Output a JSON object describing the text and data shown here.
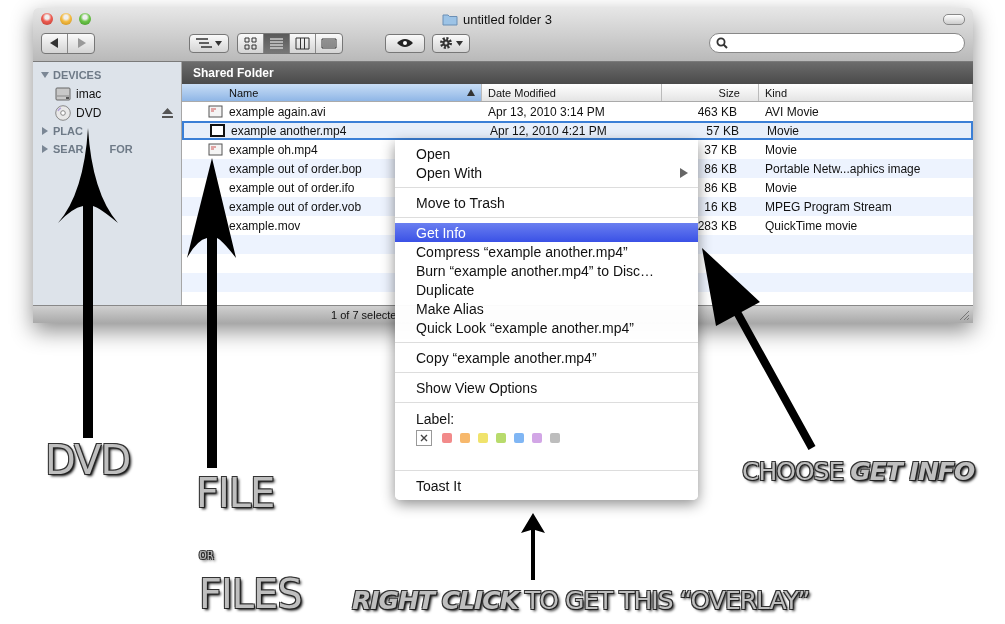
{
  "window": {
    "title": "untitled folder 3"
  },
  "toolbar": {
    "view_buttons": [
      {
        "selected": false
      },
      {
        "selected": true
      },
      {
        "selected": false
      },
      {
        "selected": false
      }
    ]
  },
  "sidebar": {
    "sections": [
      {
        "label": "DEVICES",
        "expanded": true,
        "items": [
          {
            "label": "imac",
            "kind": "disk",
            "ejectable": false
          },
          {
            "label": "DVD",
            "kind": "disc",
            "ejectable": true
          }
        ]
      },
      {
        "label": "PLAC",
        "expanded": false
      },
      {
        "label": "SEAR",
        "label_after": "FOR",
        "expanded": false
      }
    ]
  },
  "content": {
    "title": "Shared Folder",
    "columns": [
      {
        "label": "Name",
        "selected": true
      },
      {
        "label": "Date Modified",
        "selected": false
      },
      {
        "label": "Size",
        "selected": false
      },
      {
        "label": "Kind",
        "selected": false
      }
    ],
    "rows": [
      {
        "name": "example again.avi",
        "date": "Apr 13, 2010 3:14 PM",
        "size": "463 KB",
        "kind": "AVI Movie",
        "icon": true,
        "selected": false
      },
      {
        "name": "example another.mp4",
        "date": "Apr 12, 2010 4:21 PM",
        "size": "57 KB",
        "kind": "Movie",
        "icon": true,
        "selected": true
      },
      {
        "name": "example oh.mp4",
        "size": "37 KB",
        "kind": "Movie",
        "icon": true,
        "selected": false
      },
      {
        "name": "example out of order.bop",
        "size": "86 KB",
        "kind": "Portable Netw...aphics image",
        "icon": false,
        "selected": false
      },
      {
        "name": "example out of order.ifo",
        "size": "86 KB",
        "kind": "Movie",
        "icon": false,
        "selected": false
      },
      {
        "name": "example out of order.vob",
        "size": "16 KB",
        "kind": "MPEG Program Stream",
        "icon": false,
        "selected": false
      },
      {
        "name": "example.mov",
        "size": "283 KB",
        "kind": "QuickTime movie",
        "icon": false,
        "selected": false
      }
    ]
  },
  "status_bar": "1 of 7 selecte",
  "context_menu": {
    "items": [
      {
        "kind": "item",
        "label": "Open",
        "selected": false,
        "submenu": false
      },
      {
        "kind": "item",
        "label": "Open With",
        "selected": false,
        "submenu": true
      },
      {
        "kind": "separator"
      },
      {
        "kind": "item",
        "label": "Move to Trash",
        "selected": false,
        "submenu": false
      },
      {
        "kind": "separator"
      },
      {
        "kind": "item",
        "label": "Get Info",
        "selected": true,
        "submenu": false
      },
      {
        "kind": "item",
        "label": "Compress “example another.mp4”",
        "selected": false,
        "submenu": false
      },
      {
        "kind": "item",
        "label": "Burn “example another.mp4” to Disc…",
        "selected": false,
        "submenu": false
      },
      {
        "kind": "item",
        "label": "Duplicate",
        "selected": false,
        "submenu": false
      },
      {
        "kind": "item",
        "label": "Make Alias",
        "selected": false,
        "submenu": false
      },
      {
        "kind": "item",
        "label": "Quick Look “example another.mp4”",
        "selected": false,
        "submenu": false
      },
      {
        "kind": "separator"
      },
      {
        "kind": "item",
        "label": "Copy “example another.mp4”",
        "selected": false,
        "submenu": false
      },
      {
        "kind": "separator"
      },
      {
        "kind": "item",
        "label": "Show View Options",
        "selected": false,
        "submenu": false
      },
      {
        "kind": "separator"
      },
      {
        "kind": "labels",
        "label": "Label:",
        "colors": [
          {
            "color": "#f28a8a",
            "selected": false
          },
          {
            "color": "#f7b86c",
            "selected": false
          },
          {
            "color": "#f0e36c",
            "selected": false
          },
          {
            "color": "#b8db6c",
            "selected": false
          },
          {
            "color": "#80b6f4",
            "selected": false
          },
          {
            "color": "#d2a6e6",
            "selected": false
          },
          {
            "color": "#bdbdbd",
            "selected": false
          }
        ]
      },
      {
        "kind": "separator"
      },
      {
        "kind": "item",
        "label": "Toast It",
        "selected": false,
        "submenu": false
      }
    ]
  },
  "annotations": [
    {
      "kind": "big",
      "text": "DVD"
    },
    {
      "kind": "big",
      "text": "FILE"
    },
    {
      "kind": "small",
      "text": "OR"
    },
    {
      "kind": "big",
      "text": "FILES"
    },
    {
      "kind": "caption",
      "text": "CHOOSE **GET INFO**"
    },
    {
      "kind": "caption",
      "text": "**RIGHT CLICK** TO GET THIS “OVERLAY”"
    }
  ]
}
